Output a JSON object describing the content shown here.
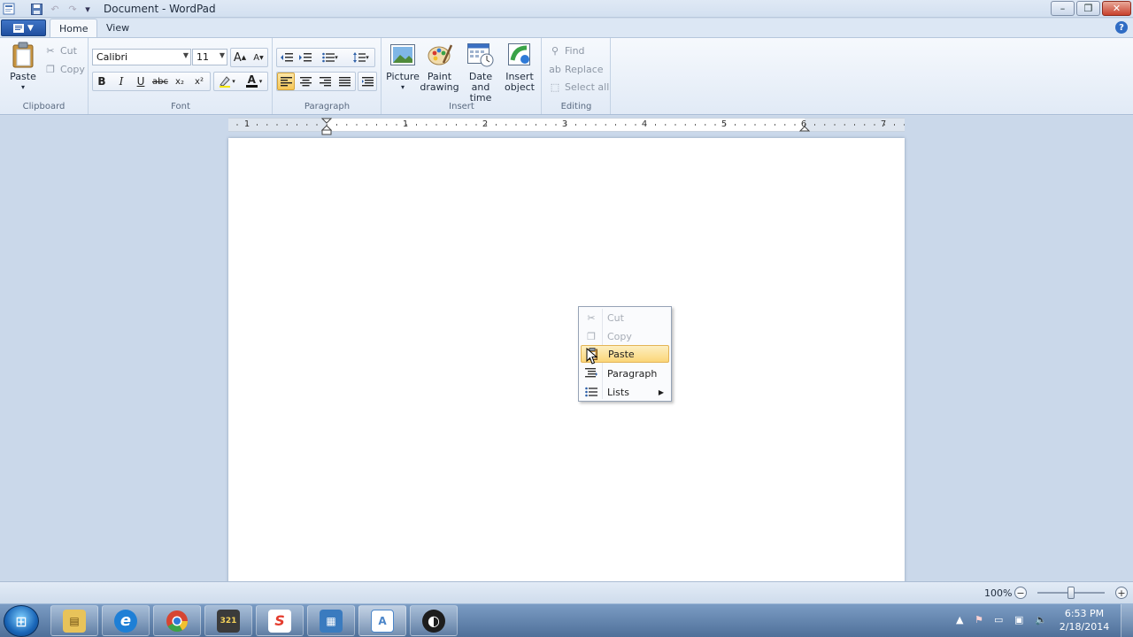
{
  "window": {
    "title": "Document - WordPad",
    "app_menu_icon": "document-menu-icon",
    "controls": {
      "minimize": "–",
      "maximize": "❐",
      "close": "✕"
    }
  },
  "quick_access": [
    {
      "name": "save-icon",
      "glyph": "▣"
    },
    {
      "name": "undo-icon",
      "glyph": "↶"
    },
    {
      "name": "redo-icon",
      "glyph": "↷"
    },
    {
      "name": "customize-dropdown-icon",
      "glyph": "▾"
    }
  ],
  "tabs": [
    {
      "label": "Home",
      "active": true
    },
    {
      "label": "View",
      "active": false
    }
  ],
  "help_glyph": "?",
  "ribbon": {
    "clipboard": {
      "label": "Clipboard",
      "paste": "Paste",
      "cut": "Cut",
      "copy": "Copy"
    },
    "font": {
      "label": "Font",
      "family": "Calibri",
      "size": "11",
      "bold": "B",
      "italic": "I",
      "underline": "U",
      "strike": "abc",
      "subscript": "x₂",
      "superscript": "x²",
      "grow": "A",
      "shrink": "A"
    },
    "paragraph": {
      "label": "Paragraph"
    },
    "insert": {
      "label": "Insert",
      "picture": "Picture",
      "paint_drawing_1": "Paint",
      "paint_drawing_2": "drawing",
      "date_time_1": "Date and",
      "date_time_2": "time",
      "insert_object_1": "Insert",
      "insert_object_2": "object"
    },
    "editing": {
      "label": "Editing",
      "find": "Find",
      "replace": "Replace",
      "select_all": "Select all"
    }
  },
  "ruler": {
    "numbers": [
      "1",
      "1",
      "2",
      "3",
      "4",
      "5",
      "6",
      "7"
    ]
  },
  "context_menu": {
    "items": [
      {
        "label": "Cut",
        "icon": "scissors-icon",
        "disabled": true
      },
      {
        "label": "Copy",
        "icon": "copy-icon",
        "disabled": true
      },
      {
        "label": "Paste",
        "icon": "paste-icon",
        "disabled": false,
        "highlighted": true
      },
      {
        "label": "Paragraph",
        "icon": "paragraph-icon",
        "disabled": false
      },
      {
        "label": "Lists",
        "icon": "list-icon",
        "disabled": false,
        "submenu": true
      }
    ]
  },
  "statusbar": {
    "zoom": "100%",
    "zoom_out": "−",
    "zoom_in": "+"
  },
  "taskbar": {
    "start_glyph": "⊞",
    "apps": [
      {
        "name": "explorer-icon",
        "glyph": "▤",
        "color": "#e8c35a"
      },
      {
        "name": "ie-icon",
        "glyph": "e",
        "color": "#1e7fd6"
      },
      {
        "name": "chrome-icon",
        "glyph": "◉",
        "color": "#d64532"
      },
      {
        "name": "video-app-icon",
        "glyph": "321",
        "color": "#3b3b3b"
      },
      {
        "name": "screen-recorder-icon",
        "glyph": "S",
        "color": "#e43c2e"
      },
      {
        "name": "control-panel-icon",
        "glyph": "▦",
        "color": "#3a7bbf"
      },
      {
        "name": "wordpad-icon",
        "glyph": "A",
        "color": "#4c86c9"
      },
      {
        "name": "obs-icon",
        "glyph": "◐",
        "color": "#1d1d1d"
      }
    ],
    "clock_time": "6:53 PM",
    "clock_date": "2/18/2014"
  }
}
